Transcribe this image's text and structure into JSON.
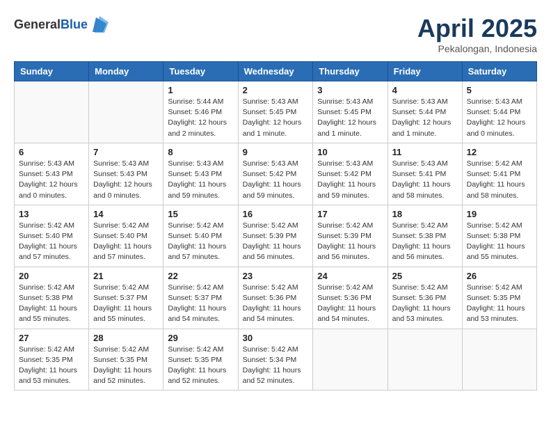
{
  "header": {
    "logo_general": "General",
    "logo_blue": "Blue",
    "month_title": "April 2025",
    "subtitle": "Pekalongan, Indonesia"
  },
  "days_of_week": [
    "Sunday",
    "Monday",
    "Tuesday",
    "Wednesday",
    "Thursday",
    "Friday",
    "Saturday"
  ],
  "weeks": [
    [
      {
        "day": "",
        "info": ""
      },
      {
        "day": "",
        "info": ""
      },
      {
        "day": "1",
        "info": "Sunrise: 5:44 AM\nSunset: 5:46 PM\nDaylight: 12 hours and 2 minutes."
      },
      {
        "day": "2",
        "info": "Sunrise: 5:43 AM\nSunset: 5:45 PM\nDaylight: 12 hours and 1 minute."
      },
      {
        "day": "3",
        "info": "Sunrise: 5:43 AM\nSunset: 5:45 PM\nDaylight: 12 hours and 1 minute."
      },
      {
        "day": "4",
        "info": "Sunrise: 5:43 AM\nSunset: 5:44 PM\nDaylight: 12 hours and 1 minute."
      },
      {
        "day": "5",
        "info": "Sunrise: 5:43 AM\nSunset: 5:44 PM\nDaylight: 12 hours and 0 minutes."
      }
    ],
    [
      {
        "day": "6",
        "info": "Sunrise: 5:43 AM\nSunset: 5:43 PM\nDaylight: 12 hours and 0 minutes."
      },
      {
        "day": "7",
        "info": "Sunrise: 5:43 AM\nSunset: 5:43 PM\nDaylight: 12 hours and 0 minutes."
      },
      {
        "day": "8",
        "info": "Sunrise: 5:43 AM\nSunset: 5:43 PM\nDaylight: 11 hours and 59 minutes."
      },
      {
        "day": "9",
        "info": "Sunrise: 5:43 AM\nSunset: 5:42 PM\nDaylight: 11 hours and 59 minutes."
      },
      {
        "day": "10",
        "info": "Sunrise: 5:43 AM\nSunset: 5:42 PM\nDaylight: 11 hours and 59 minutes."
      },
      {
        "day": "11",
        "info": "Sunrise: 5:43 AM\nSunset: 5:41 PM\nDaylight: 11 hours and 58 minutes."
      },
      {
        "day": "12",
        "info": "Sunrise: 5:42 AM\nSunset: 5:41 PM\nDaylight: 11 hours and 58 minutes."
      }
    ],
    [
      {
        "day": "13",
        "info": "Sunrise: 5:42 AM\nSunset: 5:40 PM\nDaylight: 11 hours and 57 minutes."
      },
      {
        "day": "14",
        "info": "Sunrise: 5:42 AM\nSunset: 5:40 PM\nDaylight: 11 hours and 57 minutes."
      },
      {
        "day": "15",
        "info": "Sunrise: 5:42 AM\nSunset: 5:40 PM\nDaylight: 11 hours and 57 minutes."
      },
      {
        "day": "16",
        "info": "Sunrise: 5:42 AM\nSunset: 5:39 PM\nDaylight: 11 hours and 56 minutes."
      },
      {
        "day": "17",
        "info": "Sunrise: 5:42 AM\nSunset: 5:39 PM\nDaylight: 11 hours and 56 minutes."
      },
      {
        "day": "18",
        "info": "Sunrise: 5:42 AM\nSunset: 5:38 PM\nDaylight: 11 hours and 56 minutes."
      },
      {
        "day": "19",
        "info": "Sunrise: 5:42 AM\nSunset: 5:38 PM\nDaylight: 11 hours and 55 minutes."
      }
    ],
    [
      {
        "day": "20",
        "info": "Sunrise: 5:42 AM\nSunset: 5:38 PM\nDaylight: 11 hours and 55 minutes."
      },
      {
        "day": "21",
        "info": "Sunrise: 5:42 AM\nSunset: 5:37 PM\nDaylight: 11 hours and 55 minutes."
      },
      {
        "day": "22",
        "info": "Sunrise: 5:42 AM\nSunset: 5:37 PM\nDaylight: 11 hours and 54 minutes."
      },
      {
        "day": "23",
        "info": "Sunrise: 5:42 AM\nSunset: 5:36 PM\nDaylight: 11 hours and 54 minutes."
      },
      {
        "day": "24",
        "info": "Sunrise: 5:42 AM\nSunset: 5:36 PM\nDaylight: 11 hours and 54 minutes."
      },
      {
        "day": "25",
        "info": "Sunrise: 5:42 AM\nSunset: 5:36 PM\nDaylight: 11 hours and 53 minutes."
      },
      {
        "day": "26",
        "info": "Sunrise: 5:42 AM\nSunset: 5:35 PM\nDaylight: 11 hours and 53 minutes."
      }
    ],
    [
      {
        "day": "27",
        "info": "Sunrise: 5:42 AM\nSunset: 5:35 PM\nDaylight: 11 hours and 53 minutes."
      },
      {
        "day": "28",
        "info": "Sunrise: 5:42 AM\nSunset: 5:35 PM\nDaylight: 11 hours and 52 minutes."
      },
      {
        "day": "29",
        "info": "Sunrise: 5:42 AM\nSunset: 5:35 PM\nDaylight: 11 hours and 52 minutes."
      },
      {
        "day": "30",
        "info": "Sunrise: 5:42 AM\nSunset: 5:34 PM\nDaylight: 11 hours and 52 minutes."
      },
      {
        "day": "",
        "info": ""
      },
      {
        "day": "",
        "info": ""
      },
      {
        "day": "",
        "info": ""
      }
    ]
  ]
}
